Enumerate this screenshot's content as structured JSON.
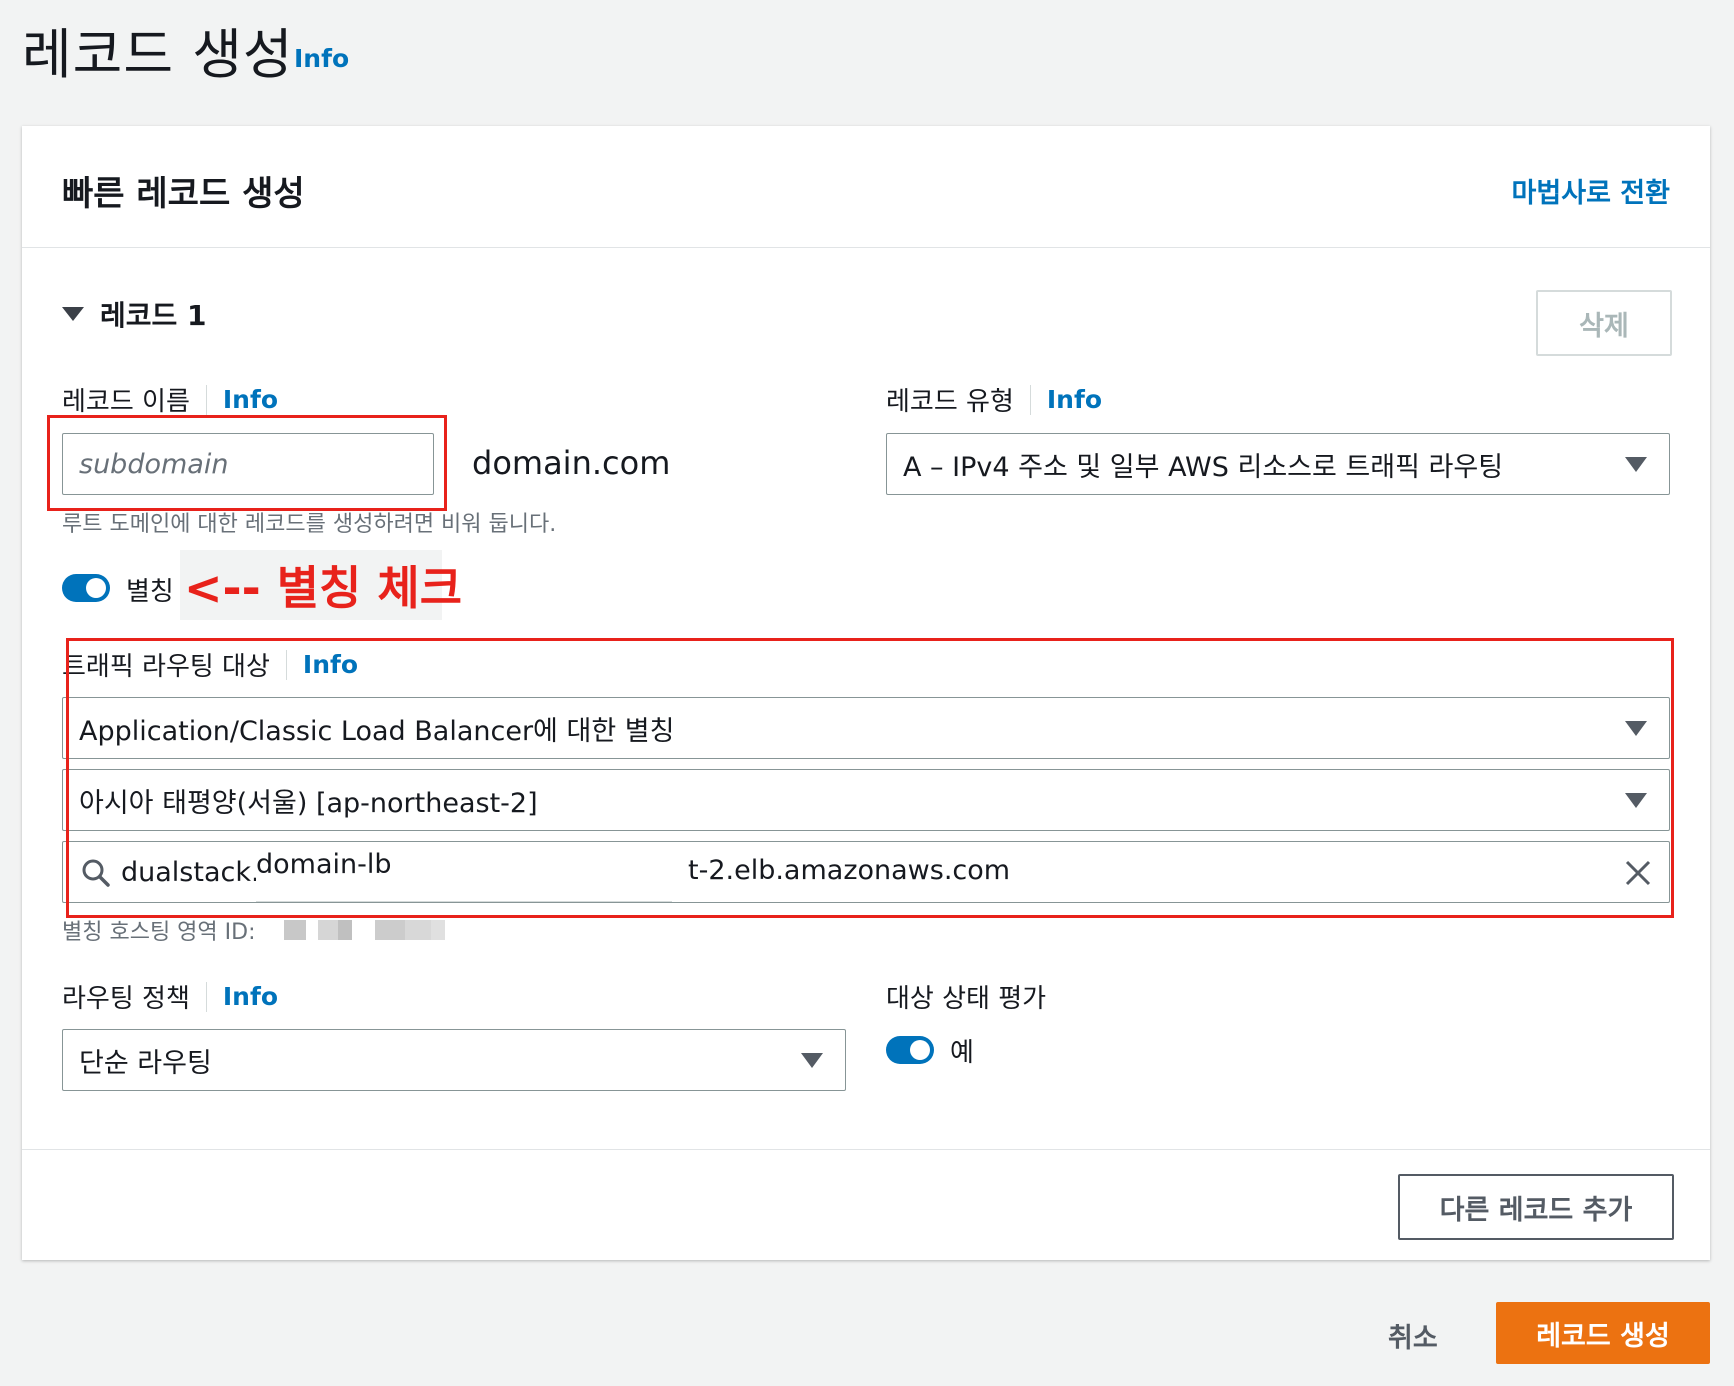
{
  "page": {
    "title": "레코드 생성",
    "info": "Info"
  },
  "card": {
    "title": "빠른 레코드 생성",
    "wizard_link": "마법사로 전환"
  },
  "record": {
    "heading": "레코드 1",
    "delete_label": "삭제",
    "name": {
      "label": "레코드 이름",
      "info": "Info",
      "placeholder": "subdomain",
      "suffix": "domain.com",
      "hint": "루트 도메인에 대한 레코드를 생성하려면 비워 둡니다."
    },
    "type": {
      "label": "레코드 유형",
      "info": "Info",
      "value": "A – IPv4 주소 및 일부 AWS 리소스로 트래픽 라우팅"
    },
    "alias": {
      "label": "별칭",
      "enabled": true
    },
    "annotation": "<-- 별칭 체크",
    "target": {
      "label": "트래픽 라우팅 대상",
      "info": "Info",
      "endpoint_type": "Application/Classic Load Balancer에 대한 별칭",
      "region": "아시아 태평양(서울) [ap-northeast-2]",
      "search_prefix": "dualstack.",
      "search_overlay": "domain-lb",
      "search_suffix": "t-2.elb.amazonaws.com",
      "hosted_zone_label": "별칭 호스팅 영역 ID:"
    },
    "routing_policy": {
      "label": "라우팅 정책",
      "info": "Info",
      "value": "단순 라우팅"
    },
    "health": {
      "label": "대상 상태 평가",
      "value": "예",
      "enabled": true
    }
  },
  "actions": {
    "add_record": "다른 레코드 추가",
    "cancel": "취소",
    "create": "레코드 생성"
  }
}
